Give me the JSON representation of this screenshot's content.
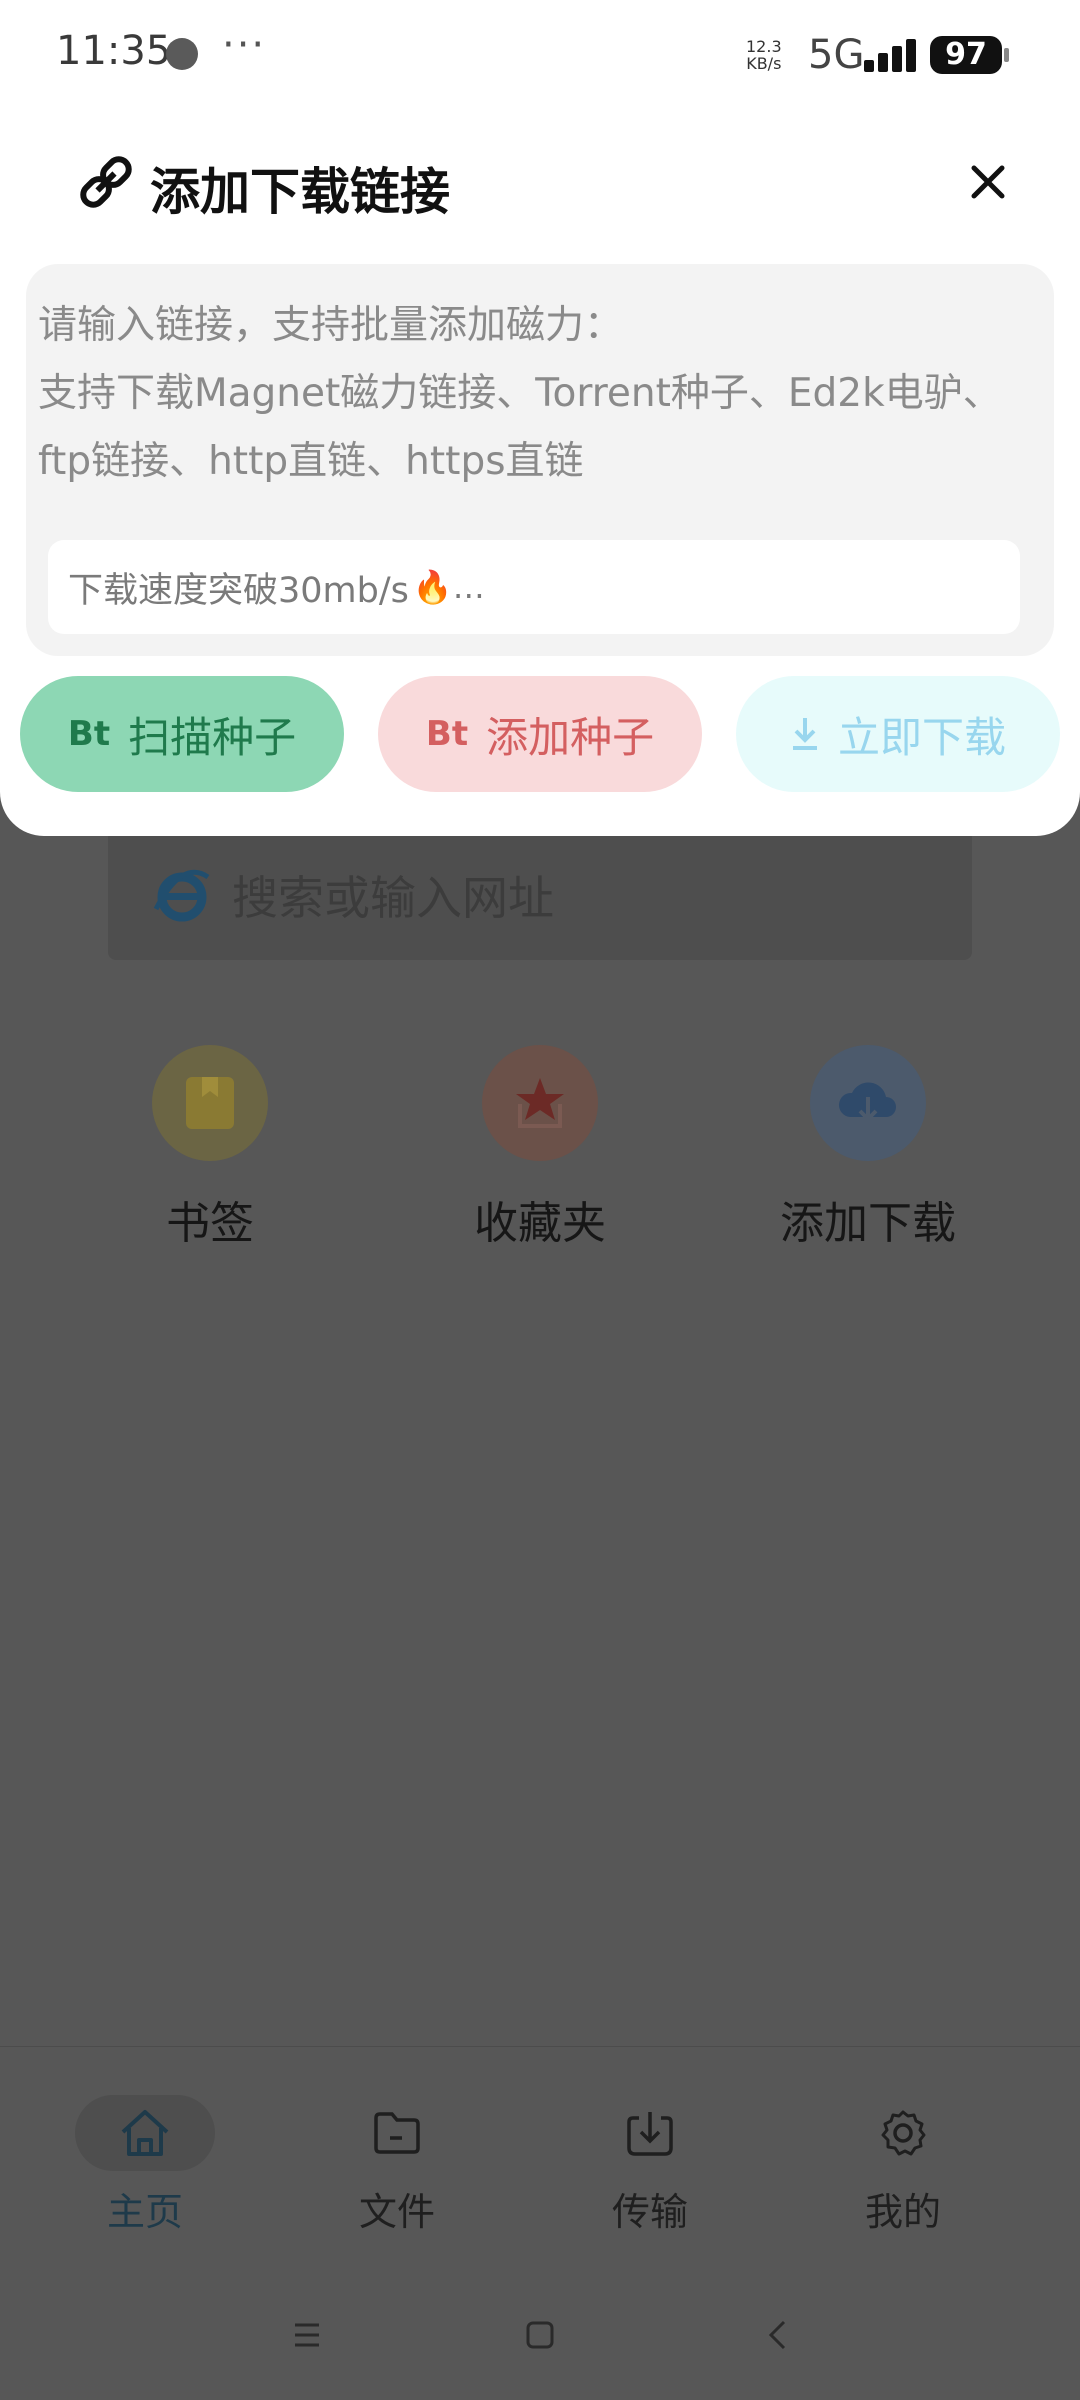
{
  "status_bar": {
    "time": "11:35",
    "more": "···",
    "speed_value": "12.3",
    "speed_unit": "KB/s",
    "network": "5G",
    "battery": "97"
  },
  "dialog": {
    "title": "添加下载链接",
    "link_input_placeholder": "请输入链接，支持批量添加磁力：\n支持下载Magnet磁力链接、Torrent种子、Ed2k电驴、ftp链接、http直链、https直链",
    "speed_banner": "下载速度突破30mb/s",
    "speed_banner_suffix": "🔥…",
    "buttons": {
      "scan_prefix": "Bt",
      "scan_label": "扫描种子",
      "add_prefix": "Bt",
      "add_label": "添加种子",
      "download_label": "立即下载"
    }
  },
  "background": {
    "search_placeholder": "搜索或输入网址",
    "quick_items": [
      {
        "label": "书签",
        "icon": "bookmark-icon"
      },
      {
        "label": "收藏夹",
        "icon": "favorites-star-icon"
      },
      {
        "label": "添加下载",
        "icon": "cloud-download-icon"
      }
    ],
    "bottom_nav": [
      {
        "label": "主页",
        "icon": "home-icon",
        "active": true
      },
      {
        "label": "文件",
        "icon": "folder-icon",
        "active": false
      },
      {
        "label": "传输",
        "icon": "transfer-icon",
        "active": false
      },
      {
        "label": "我的",
        "icon": "gear-icon",
        "active": false
      }
    ]
  },
  "colors": {
    "scan_bg": "#8dd7b4",
    "add_bg": "#f9dadb",
    "download_bg": "#e7fbfb",
    "overlay": "#575757"
  }
}
